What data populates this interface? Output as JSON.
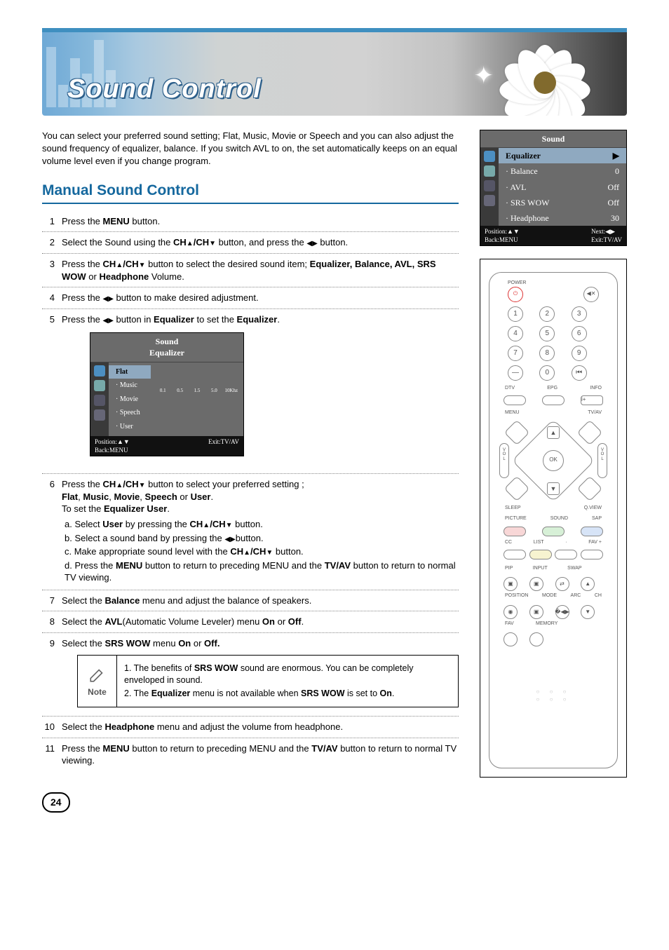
{
  "banner": {
    "title": "Sound Control"
  },
  "intro": "You can select your preferred sound setting; Flat, Music, Movie or Speech and you can also adjust the sound frequency of equalizer, balance. If you switch AVL to on, the set automatically keeps on an equal volume level even if you change program.",
  "section_heading": "Manual Sound Control",
  "steps": {
    "s1": {
      "n": "1",
      "a": "Press the ",
      "b": "MENU",
      "c": " button."
    },
    "s2": {
      "n": "2",
      "a": "Select the Sound using the ",
      "b": "CH",
      "c": "/CH",
      "d": "  button, and press the ",
      "e": "button."
    },
    "s3": {
      "n": "3",
      "a": "Press the ",
      "b": "CH",
      "c": "/CH",
      "d": " button to select the desired sound item; ",
      "e": "Equalizer, Balance, AVL,  SRS WOW",
      "f": " or ",
      "g": "Headphone",
      "h": " Volume."
    },
    "s4": {
      "n": "4",
      "a": "Press the ",
      "b": " button to make desired adjustment."
    },
    "s5": {
      "n": "5",
      "a": "Press the ",
      "b": " button in ",
      "c": "Equalizer",
      "d": " to set the ",
      "e": "Equalizer",
      "f": "."
    },
    "s6": {
      "n": "6",
      "a": "Press the ",
      "b": "CH",
      "c": "/CH",
      "d": " button to select your preferred setting ; ",
      "line2a": "Flat",
      "line2b": ", ",
      "line2c": "Music",
      "line2d": ", ",
      "line2e": "Movie",
      "line2f": ", ",
      "line2g": "Speech",
      "line2h": " or ",
      "line2i": "User",
      "line2j": ".",
      "line3a": "To set the ",
      "line3b": "Equalizer User",
      "line3c": ".",
      "sa_a": "a. Select ",
      "sa_b": "User",
      "sa_c": " by pressing the ",
      "sa_d": "CH",
      "sa_e": "/CH",
      "sa_f": "  button.",
      "sb_a": "b. Select a sound band by pressing the  ",
      "sb_b": "button.",
      "sc_a": "c. Make appropriate sound level with the ",
      "sc_b": "CH",
      "sc_c": "/CH",
      "sc_d": "  button.",
      "sd_a": "d. Press the ",
      "sd_b": "MENU",
      "sd_c": " button to return to preceding MENU and the ",
      "sd_d": "TV/AV",
      "sd_e": " button to return to normal TV viewing."
    },
    "s7": {
      "n": "7",
      "a": "Select the ",
      "b": "Balance",
      "c": " menu and adjust the balance of speakers."
    },
    "s8": {
      "n": "8",
      "a": "Select the ",
      "b": "AVL",
      "c": "(Automatic Volume Leveler) menu ",
      "d": "On",
      "e": " or ",
      "f": "Off",
      "g": "."
    },
    "s9": {
      "n": "9",
      "a": "Select the ",
      "b": "SRS WOW",
      "c": " menu ",
      "d": "On",
      "e": " or ",
      "f": "Off."
    },
    "s10": {
      "n": "10",
      "a": "Select the ",
      "b": "Headphone",
      "c": " menu and adjust the volume from headphone."
    },
    "s11": {
      "n": "11",
      "a": "Press the ",
      "b": "MENU",
      "c": " button to return to preceding MENU and the ",
      "d": "TV/AV",
      "e": " button to return to normal TV viewing."
    }
  },
  "note": {
    "label": "Note",
    "l1a": "1. The benefits of ",
    "l1b": "SRS WOW",
    "l1c": " sound are enormous. You can be completely enveloped in sound.",
    "l2a": "2. The ",
    "l2b": "Equalizer",
    "l2c": " menu is not available when ",
    "l2d": "SRS WOW",
    "l2e": " is set to ",
    "l2f": "On",
    "l2g": "."
  },
  "osd_sound": {
    "title": "Sound",
    "rows": [
      {
        "label": "Equalizer",
        "value": "▶"
      },
      {
        "label": "Balance",
        "value": "0"
      },
      {
        "label": "AVL",
        "value": "Off"
      },
      {
        "label": "SRS WOW",
        "value": "Off"
      },
      {
        "label": "Headphone",
        "value": "30"
      }
    ],
    "foot_l": "Position:▲▼\nBack:MENU",
    "foot_r": "Next:◀▶\nExit:TV/AV"
  },
  "osd_eq": {
    "title1": "Sound",
    "title2": "Equalizer",
    "items": [
      "Flat",
      "Music",
      "Movie",
      "Speech",
      "User"
    ],
    "bands": [
      "0.1",
      "0.5",
      "1.5",
      "5.0",
      "10Khz"
    ],
    "foot_l": "Position:▲▼\nBack:MENU",
    "foot_r": "Exit:TV/AV"
  },
  "remote": {
    "power": "POWER",
    "mute": "◀✕",
    "numbers": [
      "1",
      "2",
      "3",
      "4",
      "5",
      "6",
      "7",
      "8",
      "9",
      "—",
      "0",
      "⏮"
    ],
    "row_lbl": [
      "DTV",
      "EPG",
      "INFO"
    ],
    "menu": "MENU",
    "tvav": "TV/AV",
    "ok": "OK",
    "vol": "V\nO\nL",
    "sleep": "SLEEP",
    "qview": "Q.VIEW",
    "trio": [
      "PICTURE",
      "SOUND",
      "SAP"
    ],
    "quad": [
      "CC",
      "LIST",
      "·",
      "FAV +"
    ],
    "grid_lbl1": [
      "PIP",
      "INPUT",
      "SWAP",
      ""
    ],
    "grid_lbl2": [
      "POSITION",
      "MODE",
      "ARC",
      "CH"
    ],
    "grid_lbl3": [
      "FAV",
      "MEMORY",
      "",
      ""
    ]
  },
  "page": "24"
}
